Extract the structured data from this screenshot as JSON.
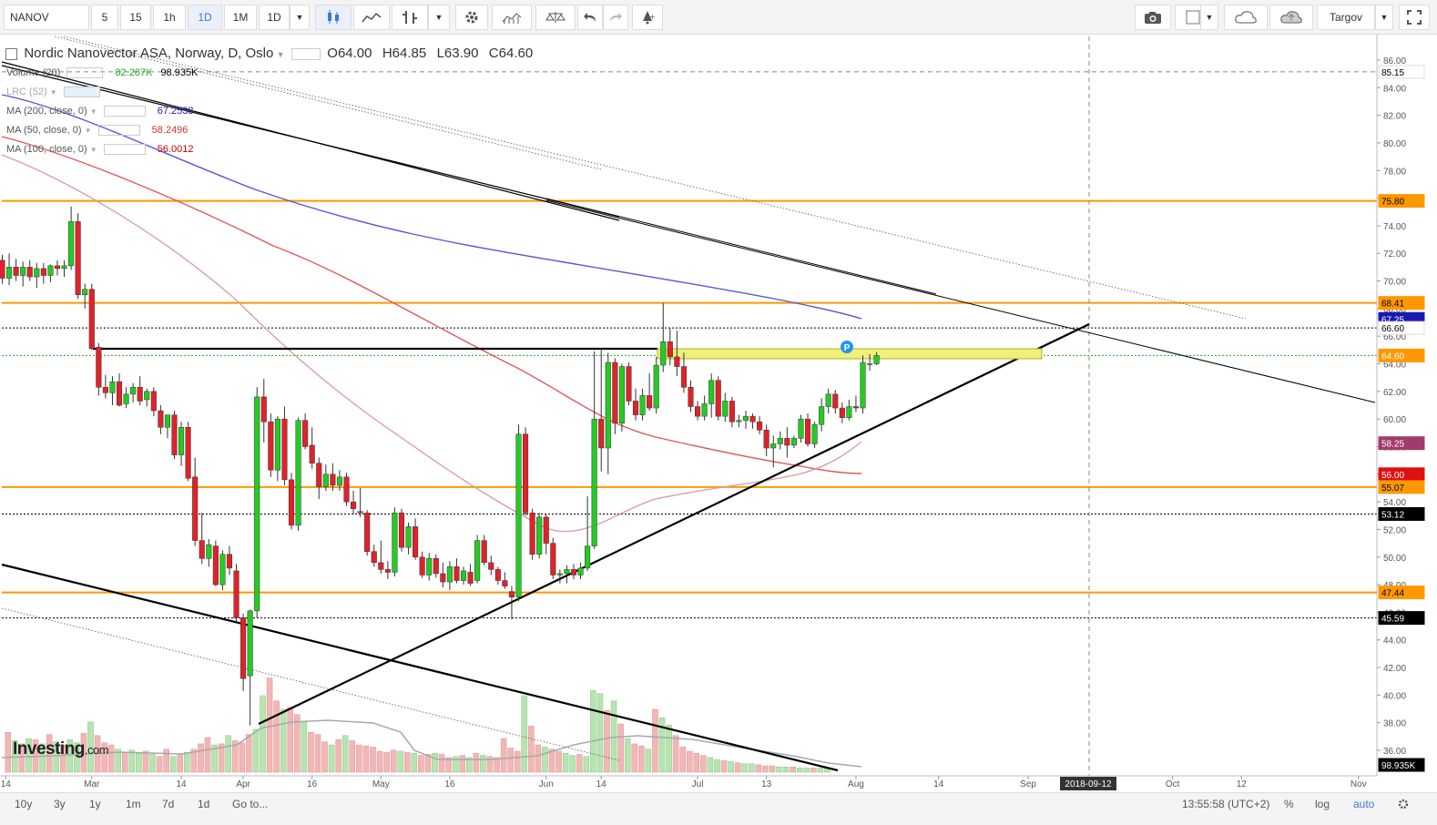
{
  "toolbar": {
    "symbol": "NANOV",
    "intervals": [
      "5",
      "15",
      "1h",
      "1D",
      "1M",
      "1D"
    ],
    "active_interval_index": 3,
    "user": "Targov",
    "accent": "#3a7bd5"
  },
  "legend": {
    "title": "Nordic Nanovector ASA, Norway, D, Oslo",
    "open_label": "O64.00",
    "high_label": "H64.85",
    "low_label": "L63.90",
    "close_label": "C64.60",
    "indicators": [
      {
        "name": "Volume (20)",
        "values": [
          "82.287K",
          "98.935K"
        ],
        "colors": [
          "#22aa22",
          "#000000"
        ]
      },
      {
        "name": "LRC (52)",
        "values": [],
        "colors": []
      },
      {
        "name": "MA (200, close, 0)",
        "values": [
          "67.2538"
        ],
        "colors": [
          "#1a1ab0"
        ]
      },
      {
        "name": "MA (50, close, 0)",
        "values": [
          "58.2496"
        ],
        "colors": [
          "#cc3333"
        ]
      },
      {
        "name": "MA (100, close, 0)",
        "values": [
          "56.0012"
        ],
        "colors": [
          "#cc0000"
        ]
      }
    ]
  },
  "chart_data": {
    "type": "candlestick",
    "ylim": [
      35,
      87
    ],
    "y_ticks": [
      "86.00",
      "84.00",
      "82.00",
      "80.00",
      "78.00",
      "76.00",
      "74.00",
      "72.00",
      "70.00",
      "68.00",
      "66.00",
      "64.00",
      "62.00",
      "60.00",
      "58.00",
      "56.00",
      "54.00",
      "52.00",
      "50.00",
      "48.00",
      "46.00",
      "44.00",
      "42.00",
      "40.00",
      "38.00",
      "36.00"
    ],
    "x_labels": [
      "14",
      "Mar",
      "14",
      "Apr",
      "16",
      "May",
      "16",
      "Jun",
      "14",
      "Jul",
      "13",
      "Aug",
      "14",
      "Sep",
      "Oct",
      "12",
      "Nov"
    ],
    "crosshair_date": "2018-09-12",
    "crosshair_price": "85.15",
    "price_labels": [
      {
        "value": "85.15",
        "bg": "#ffffff",
        "fg": "#000000"
      },
      {
        "value": "75.80",
        "bg": "#ff9800",
        "fg": "#000000"
      },
      {
        "value": "68.41",
        "bg": "#ff9800",
        "fg": "#000000"
      },
      {
        "value": "67.25",
        "bg": "#1a1ab0",
        "fg": "#ffffff"
      },
      {
        "value": "66.60",
        "bg": "#ffffff",
        "fg": "#000000"
      },
      {
        "value": "64.60",
        "bg": "#ff9800",
        "fg": "#ffffff"
      },
      {
        "value": "58.25",
        "bg": "#a23a6c",
        "fg": "#ffffff"
      },
      {
        "value": "56.00",
        "bg": "#dd1111",
        "fg": "#ffffff"
      },
      {
        "value": "55.07",
        "bg": "#ff9800",
        "fg": "#000000"
      },
      {
        "value": "53.12",
        "bg": "#000000",
        "fg": "#ffffff"
      },
      {
        "value": "47.44",
        "bg": "#ff9800",
        "fg": "#000000"
      },
      {
        "value": "45.59",
        "bg": "#000000",
        "fg": "#ffffff"
      },
      {
        "value": "98.935K",
        "bg": "#000000",
        "fg": "#ffffff"
      }
    ],
    "horizontal_levels": [
      {
        "price": 75.8,
        "color": "#ff9800",
        "style": "solid"
      },
      {
        "price": 68.41,
        "color": "#ff9800",
        "style": "solid"
      },
      {
        "price": 66.6,
        "color": "#000000",
        "style": "dotted"
      },
      {
        "price": 64.6,
        "color": "#22aa22",
        "style": "dotted"
      },
      {
        "price": 55.07,
        "color": "#ff9800",
        "style": "solid"
      },
      {
        "price": 53.12,
        "color": "#000000",
        "style": "dotted"
      },
      {
        "price": 47.44,
        "color": "#ff9800",
        "style": "solid"
      },
      {
        "price": 45.59,
        "color": "#000000",
        "style": "dotted"
      }
    ],
    "candles": [
      [
        71.5,
        71.9,
        69.8,
        70.2
      ],
      [
        70.2,
        72.0,
        69.7,
        71.0
      ],
      [
        71.0,
        71.6,
        70.0,
        70.4
      ],
      [
        70.4,
        71.4,
        69.6,
        71.0
      ],
      [
        71.0,
        71.5,
        70.0,
        70.3
      ],
      [
        70.3,
        71.3,
        69.5,
        70.9
      ],
      [
        70.9,
        71.3,
        69.8,
        70.4
      ],
      [
        70.4,
        71.2,
        69.9,
        71.1
      ],
      [
        71.1,
        71.5,
        70.4,
        70.9
      ],
      [
        70.9,
        71.5,
        70.3,
        71.1
      ],
      [
        71.1,
        75.4,
        70.8,
        74.3
      ],
      [
        74.3,
        74.9,
        68.7,
        69.0
      ],
      [
        69.0,
        69.8,
        68.0,
        69.4
      ],
      [
        69.4,
        69.8,
        65.0,
        65.1
      ],
      [
        65.2,
        65.5,
        61.7,
        62.3
      ],
      [
        62.3,
        63.2,
        61.5,
        61.9
      ],
      [
        61.9,
        63.1,
        61.0,
        62.7
      ],
      [
        62.7,
        63.3,
        60.9,
        61.0
      ],
      [
        61.1,
        62.3,
        60.8,
        61.8
      ],
      [
        61.8,
        62.6,
        61.2,
        62.3
      ],
      [
        62.3,
        63.1,
        61.0,
        61.3
      ],
      [
        61.4,
        62.2,
        60.9,
        62.0
      ],
      [
        62.0,
        62.3,
        60.2,
        60.6
      ],
      [
        60.6,
        61.0,
        58.9,
        59.4
      ],
      [
        59.4,
        60.3,
        58.6,
        60.3
      ],
      [
        60.3,
        60.6,
        57.1,
        57.4
      ],
      [
        57.4,
        59.8,
        56.6,
        59.4
      ],
      [
        59.4,
        59.8,
        55.5,
        55.7
      ],
      [
        55.8,
        57.2,
        50.8,
        51.2
      ],
      [
        51.2,
        53.2,
        49.5,
        49.9
      ],
      [
        49.9,
        51.3,
        49.3,
        50.9
      ],
      [
        50.8,
        51.2,
        47.9,
        48.0
      ],
      [
        48.0,
        50.5,
        47.6,
        50.2
      ],
      [
        50.2,
        50.8,
        48.7,
        49.2
      ],
      [
        49.0,
        49.5,
        45.3,
        45.6
      ],
      [
        45.6,
        45.9,
        40.3,
        41.2
      ],
      [
        41.4,
        46.2,
        37.8,
        46.1
      ],
      [
        46.1,
        62.3,
        45.6,
        61.6
      ],
      [
        61.6,
        62.9,
        58.3,
        59.8
      ],
      [
        59.8,
        60.4,
        55.8,
        56.3
      ],
      [
        56.3,
        60.2,
        55.5,
        60.0
      ],
      [
        60.0,
        60.9,
        55.2,
        55.6
      ],
      [
        55.6,
        56.1,
        52.0,
        52.3
      ],
      [
        52.3,
        60.1,
        51.9,
        59.9
      ],
      [
        59.9,
        60.4,
        57.8,
        58.0
      ],
      [
        58.1,
        59.4,
        56.4,
        56.8
      ],
      [
        56.8,
        57.2,
        54.2,
        55.1
      ],
      [
        55.1,
        56.7,
        54.8,
        56.0
      ],
      [
        56.0,
        56.8,
        54.8,
        55.2
      ],
      [
        55.2,
        56.3,
        54.8,
        55.8
      ],
      [
        55.8,
        56.1,
        53.7,
        54.0
      ],
      [
        54.0,
        54.8,
        53.1,
        53.5
      ],
      [
        53.3,
        55.0,
        52.9,
        53.2
      ],
      [
        53.2,
        53.4,
        50.1,
        50.4
      ],
      [
        50.4,
        50.9,
        49.3,
        49.6
      ],
      [
        49.6,
        51.2,
        48.8,
        49.1
      ],
      [
        49.1,
        49.7,
        48.4,
        48.9
      ],
      [
        48.9,
        53.6,
        48.6,
        53.2
      ],
      [
        53.2,
        53.5,
        50.4,
        50.7
      ],
      [
        50.7,
        52.5,
        50.2,
        52.2
      ],
      [
        52.2,
        52.8,
        49.8,
        50.0
      ],
      [
        50.0,
        50.4,
        48.5,
        48.7
      ],
      [
        48.7,
        50.3,
        48.3,
        49.9
      ],
      [
        49.9,
        50.2,
        48.5,
        48.8
      ],
      [
        48.8,
        49.6,
        47.8,
        48.2
      ],
      [
        48.2,
        49.7,
        47.6,
        49.3
      ],
      [
        49.3,
        49.9,
        48.1,
        48.3
      ],
      [
        48.3,
        49.3,
        48.0,
        49.0
      ],
      [
        48.9,
        49.5,
        47.9,
        48.1
      ],
      [
        48.3,
        51.6,
        48.1,
        51.2
      ],
      [
        51.2,
        51.6,
        49.4,
        49.6
      ],
      [
        49.6,
        50.1,
        48.7,
        49.1
      ],
      [
        49.1,
        49.3,
        48.0,
        48.3
      ],
      [
        48.3,
        48.9,
        47.7,
        47.9
      ],
      [
        47.5,
        47.9,
        45.5,
        47.1
      ],
      [
        47.1,
        59.6,
        46.8,
        58.9
      ],
      [
        58.9,
        59.4,
        53.0,
        53.2
      ],
      [
        53.2,
        53.5,
        49.8,
        50.2
      ],
      [
        50.2,
        53.2,
        49.9,
        52.9
      ],
      [
        52.9,
        53.1,
        50.2,
        51.0
      ],
      [
        51.0,
        51.4,
        48.4,
        48.7
      ],
      [
        48.7,
        49.1,
        48.1,
        48.8
      ],
      [
        48.8,
        49.4,
        48.1,
        49.1
      ],
      [
        49.1,
        49.5,
        48.4,
        48.7
      ],
      [
        48.7,
        49.6,
        48.4,
        49.2
      ],
      [
        49.2,
        54.4,
        49.0,
        50.8
      ],
      [
        50.8,
        64.9,
        50.6,
        60.0
      ],
      [
        60.0,
        65.0,
        56.2,
        57.9
      ],
      [
        57.9,
        64.8,
        56.0,
        64.1
      ],
      [
        64.1,
        64.4,
        58.9,
        59.7
      ],
      [
        59.7,
        64.0,
        59.1,
        63.8
      ],
      [
        63.8,
        64.1,
        61.0,
        61.3
      ],
      [
        61.3,
        62.2,
        59.9,
        60.3
      ],
      [
        60.3,
        62.2,
        59.9,
        61.7
      ],
      [
        61.7,
        63.3,
        60.6,
        60.8
      ],
      [
        60.8,
        64.5,
        60.4,
        63.9
      ],
      [
        63.9,
        68.4,
        63.4,
        65.6
      ],
      [
        65.6,
        66.6,
        63.9,
        64.5
      ],
      [
        64.5,
        66.4,
        63.1,
        63.8
      ],
      [
        63.8,
        64.8,
        61.9,
        62.3
      ],
      [
        62.3,
        62.8,
        60.5,
        60.9
      ],
      [
        60.9,
        61.3,
        59.9,
        60.2
      ],
      [
        60.2,
        61.7,
        59.9,
        61.1
      ],
      [
        61.1,
        63.3,
        60.1,
        62.8
      ],
      [
        62.8,
        63.1,
        59.9,
        60.2
      ],
      [
        60.2,
        61.9,
        59.8,
        61.3
      ],
      [
        61.3,
        61.6,
        59.4,
        59.8
      ],
      [
        59.8,
        60.3,
        59.4,
        59.9
      ],
      [
        59.9,
        60.6,
        59.3,
        60.2
      ],
      [
        60.2,
        60.4,
        59.3,
        59.8
      ],
      [
        59.8,
        60.2,
        58.9,
        59.2
      ],
      [
        59.2,
        59.6,
        57.3,
        57.9
      ],
      [
        57.9,
        58.8,
        56.5,
        58.2
      ],
      [
        58.2,
        59.1,
        57.8,
        58.6
      ],
      [
        58.6,
        59.4,
        57.2,
        58.1
      ],
      [
        58.1,
        58.8,
        57.9,
        58.6
      ],
      [
        58.6,
        60.3,
        58.3,
        60.0
      ],
      [
        60.0,
        60.4,
        58.0,
        58.2
      ],
      [
        58.2,
        59.8,
        57.9,
        59.6
      ],
      [
        59.6,
        61.5,
        59.1,
        60.9
      ],
      [
        60.9,
        62.2,
        60.4,
        61.8
      ],
      [
        61.8,
        62.1,
        60.4,
        60.8
      ],
      [
        60.8,
        61.2,
        59.7,
        60.1
      ],
      [
        60.1,
        61.4,
        59.9,
        60.9
      ],
      [
        60.9,
        61.7,
        60.5,
        60.8
      ],
      [
        60.8,
        64.6,
        60.4,
        64.1
      ],
      [
        64.0,
        64.7,
        63.5,
        64.0
      ],
      [
        64.0,
        64.85,
        63.9,
        64.6
      ]
    ],
    "volume": [
      [
        1,
        38
      ],
      [
        3,
        30
      ],
      [
        5,
        27
      ],
      [
        7,
        32
      ],
      [
        9,
        31
      ],
      [
        11,
        27
      ],
      [
        13,
        36
      ],
      [
        15,
        29
      ],
      [
        17,
        26
      ],
      [
        19,
        31
      ],
      [
        21,
        28
      ],
      [
        23,
        37
      ],
      [
        25,
        48
      ],
      [
        27,
        35
      ],
      [
        29,
        28
      ],
      [
        31,
        26
      ],
      [
        33,
        22
      ],
      [
        35,
        19
      ],
      [
        37,
        21
      ],
      [
        39,
        18
      ],
      [
        41,
        20
      ],
      [
        43,
        17
      ],
      [
        45,
        15
      ],
      [
        47,
        22
      ],
      [
        49,
        15
      ],
      [
        51,
        17
      ],
      [
        53,
        19
      ],
      [
        55,
        22
      ],
      [
        57,
        27
      ],
      [
        59,
        33
      ],
      [
        61,
        26
      ],
      [
        63,
        27
      ],
      [
        65,
        35
      ],
      [
        67,
        30
      ],
      [
        69,
        28
      ],
      [
        71,
        36
      ],
      [
        73,
        41
      ],
      [
        75,
        73
      ],
      [
        77,
        90
      ],
      [
        79,
        68
      ],
      [
        81,
        60
      ],
      [
        83,
        62
      ],
      [
        85,
        55
      ],
      [
        87,
        48
      ],
      [
        89,
        38
      ],
      [
        91,
        36
      ],
      [
        93,
        29
      ],
      [
        95,
        26
      ],
      [
        97,
        31
      ],
      [
        99,
        35
      ],
      [
        101,
        30
      ],
      [
        103,
        26
      ],
      [
        105,
        25
      ],
      [
        107,
        24
      ],
      [
        109,
        20
      ],
      [
        111,
        19
      ],
      [
        113,
        21
      ],
      [
        115,
        20
      ],
      [
        117,
        19
      ],
      [
        119,
        18
      ],
      [
        121,
        16
      ],
      [
        123,
        17
      ],
      [
        125,
        18
      ],
      [
        127,
        17
      ],
      [
        129,
        14
      ],
      [
        131,
        15
      ],
      [
        133,
        16
      ],
      [
        135,
        14
      ],
      [
        137,
        18
      ],
      [
        139,
        16
      ],
      [
        141,
        15
      ],
      [
        143,
        14
      ],
      [
        145,
        32
      ],
      [
        147,
        23
      ],
      [
        149,
        20
      ],
      [
        151,
        73
      ],
      [
        153,
        44
      ],
      [
        155,
        26
      ],
      [
        157,
        24
      ],
      [
        159,
        22
      ],
      [
        161,
        20
      ],
      [
        163,
        18
      ],
      [
        165,
        16
      ],
      [
        167,
        17
      ],
      [
        169,
        15
      ],
      [
        171,
        78
      ],
      [
        173,
        75
      ],
      [
        175,
        59
      ],
      [
        177,
        68
      ],
      [
        179,
        46
      ],
      [
        181,
        32
      ],
      [
        183,
        27
      ],
      [
        185,
        25
      ],
      [
        187,
        22
      ],
      [
        189,
        60
      ],
      [
        191,
        52
      ],
      [
        193,
        45
      ],
      [
        195,
        35
      ],
      [
        197,
        24
      ],
      [
        199,
        20
      ],
      [
        201,
        18
      ],
      [
        203,
        16
      ],
      [
        205,
        14
      ],
      [
        207,
        12
      ],
      [
        209,
        11
      ],
      [
        211,
        10
      ],
      [
        213,
        9
      ],
      [
        215,
        8
      ],
      [
        217,
        8
      ],
      [
        219,
        7
      ],
      [
        221,
        6
      ],
      [
        223,
        6
      ],
      [
        225,
        5
      ],
      [
        227,
        5
      ],
      [
        229,
        5
      ],
      [
        231,
        4
      ],
      [
        233,
        4
      ],
      [
        235,
        4
      ],
      [
        237,
        4
      ],
      [
        239,
        4
      ]
    ]
  },
  "bottombar": {
    "ranges": [
      "10y",
      "3y",
      "1y",
      "1m",
      "7d",
      "1d",
      "Go to..."
    ],
    "time": "13:55:58 (UTC+2)",
    "percent": "%",
    "log": "log",
    "auto": "auto"
  },
  "logo": {
    "name": "Investing",
    "suffix": ".com"
  },
  "marker": "P"
}
